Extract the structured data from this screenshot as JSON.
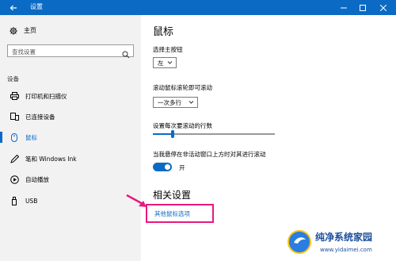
{
  "window": {
    "title": "设置",
    "controls": [
      "minimize-icon",
      "maximize-icon",
      "close-icon"
    ]
  },
  "colors": {
    "accent": "#0b6bc4",
    "highlight": "#e8197d",
    "sidebar_bg": "#f2f2f2"
  },
  "sidebar": {
    "home": "主页",
    "search_placeholder": "查找设置",
    "section": "设备",
    "items": [
      {
        "label": "打印机和扫描仪",
        "icon": "printer-icon"
      },
      {
        "label": "已连接设备",
        "icon": "devices-icon"
      },
      {
        "label": "鼠标",
        "icon": "mouse-icon",
        "active": true
      },
      {
        "label": "笔和 Windows Ink",
        "icon": "pen-icon"
      },
      {
        "label": "自动播放",
        "icon": "autoplay-icon"
      },
      {
        "label": "USB",
        "icon": "usb-icon"
      }
    ]
  },
  "main": {
    "title": "鼠标",
    "primary_button_label": "选择主按钮",
    "primary_button_value": "左",
    "scroll_label": "滚动鼠标滚轮即可滚动",
    "scroll_value": "一次多行",
    "lines_label": "设置每次要滚动的行数",
    "lines_slider_level": 0.16,
    "inactive_scroll_label": "当我悬停在非活动窗口上方时对其进行滚动",
    "toggle_state": "开",
    "related_title": "相关设置",
    "related_link": "其他鼠标选项"
  },
  "watermark": {
    "text": "纯净系统家园",
    "url": "www.yidaimei.com"
  }
}
